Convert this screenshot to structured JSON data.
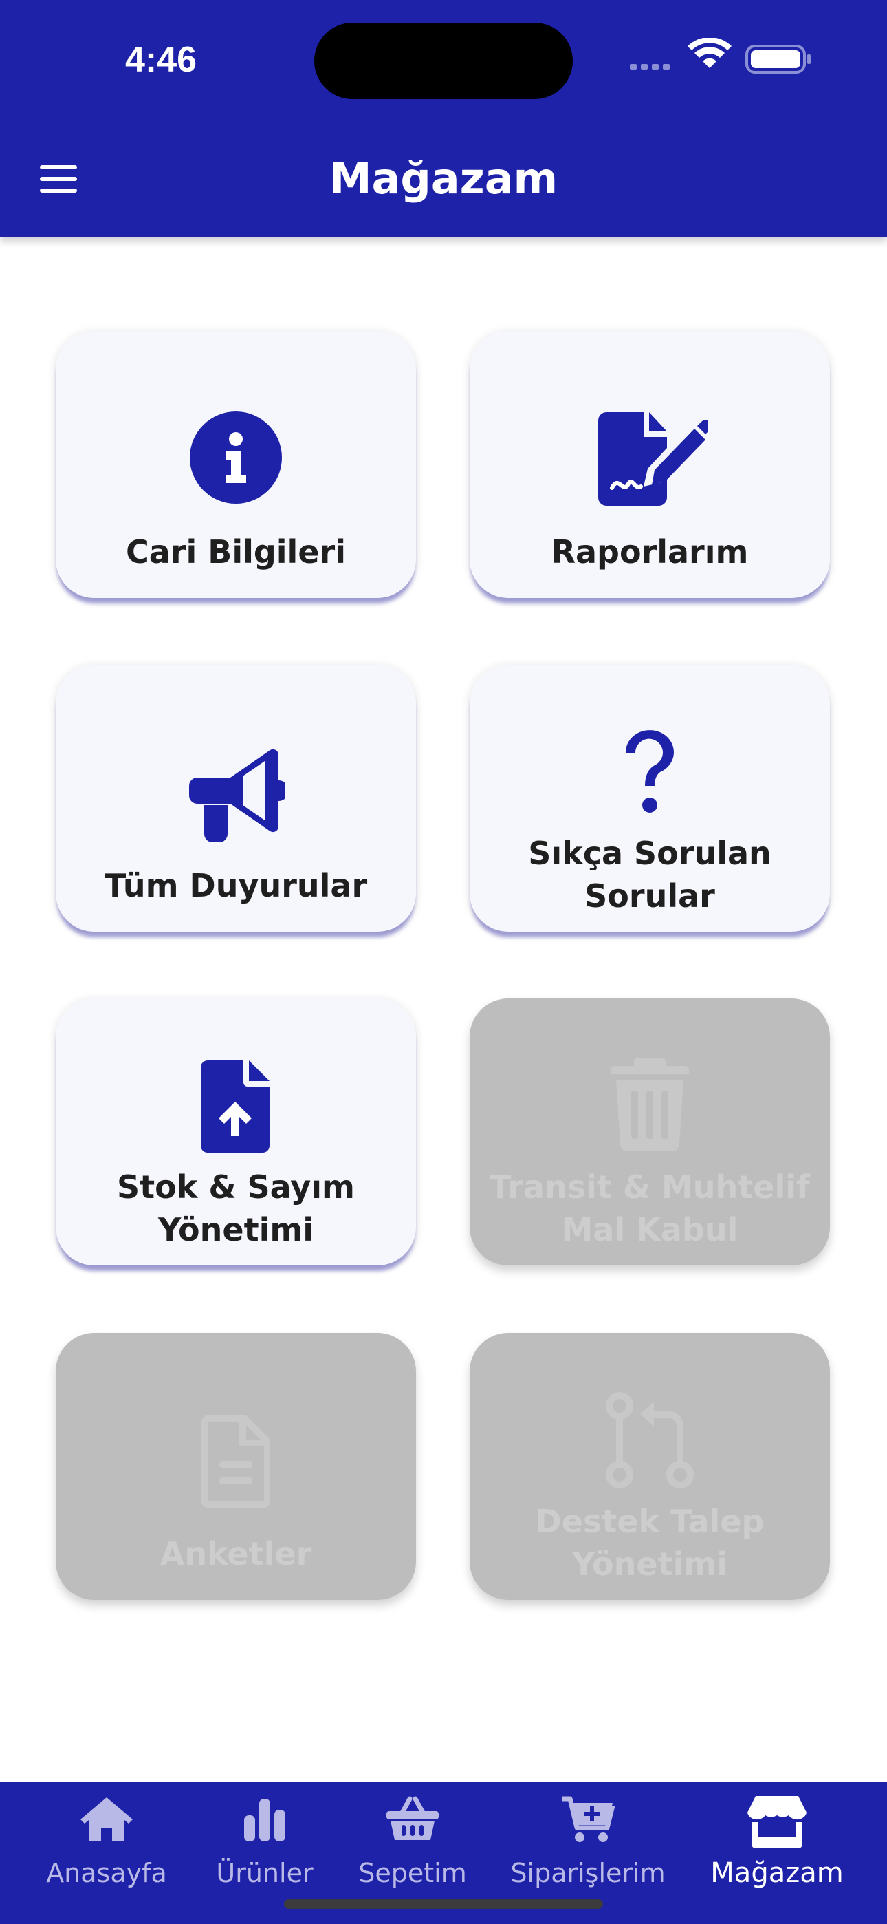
{
  "status_bar": {
    "time": "4:46"
  },
  "header": {
    "title": "Mağazam"
  },
  "tiles": [
    {
      "label_lines": [
        "Cari Bilgileri"
      ],
      "icon": "info-circle-icon",
      "enabled": true
    },
    {
      "label_lines": [
        "Raporlarım"
      ],
      "icon": "file-signature-icon",
      "enabled": true
    },
    {
      "label_lines": [
        "Tüm Duyurular"
      ],
      "icon": "megaphone-icon",
      "enabled": true
    },
    {
      "label_lines": [
        "Sıkça Sorulan",
        "Sorular"
      ],
      "icon": "question-mark-icon",
      "enabled": true
    },
    {
      "label_lines": [
        "Stok & Sayım",
        "Yönetimi"
      ],
      "icon": "file-upload-icon",
      "enabled": true
    },
    {
      "label_lines": [
        "Transit & Muhtelif",
        "Mal Kabul"
      ],
      "icon": "trash-icon",
      "enabled": false
    },
    {
      "label_lines": [
        "Anketler"
      ],
      "icon": "document-icon",
      "enabled": false
    },
    {
      "label_lines": [
        "Destek Talep",
        "Yönetimi"
      ],
      "icon": "code-pull-request-icon",
      "enabled": false
    }
  ],
  "tab_bar": {
    "items": [
      {
        "label": "Anasayfa",
        "icon": "home-icon",
        "active": false
      },
      {
        "label": "Ürünler",
        "icon": "bar-chart-icon",
        "active": false
      },
      {
        "label": "Sepetim",
        "icon": "basket-icon",
        "active": false
      },
      {
        "label": "Siparişlerim",
        "icon": "cart-plus-icon",
        "active": false
      },
      {
        "label": "Mağazam",
        "icon": "store-icon",
        "active": true
      }
    ]
  },
  "colors": {
    "primary": "#1e22a8",
    "tile_bg": "#f6f6fd",
    "tile_disabled": "#bdbdbd",
    "label_disabled": "#cdcdcd",
    "tab_inactive": "#b8b9e6"
  }
}
